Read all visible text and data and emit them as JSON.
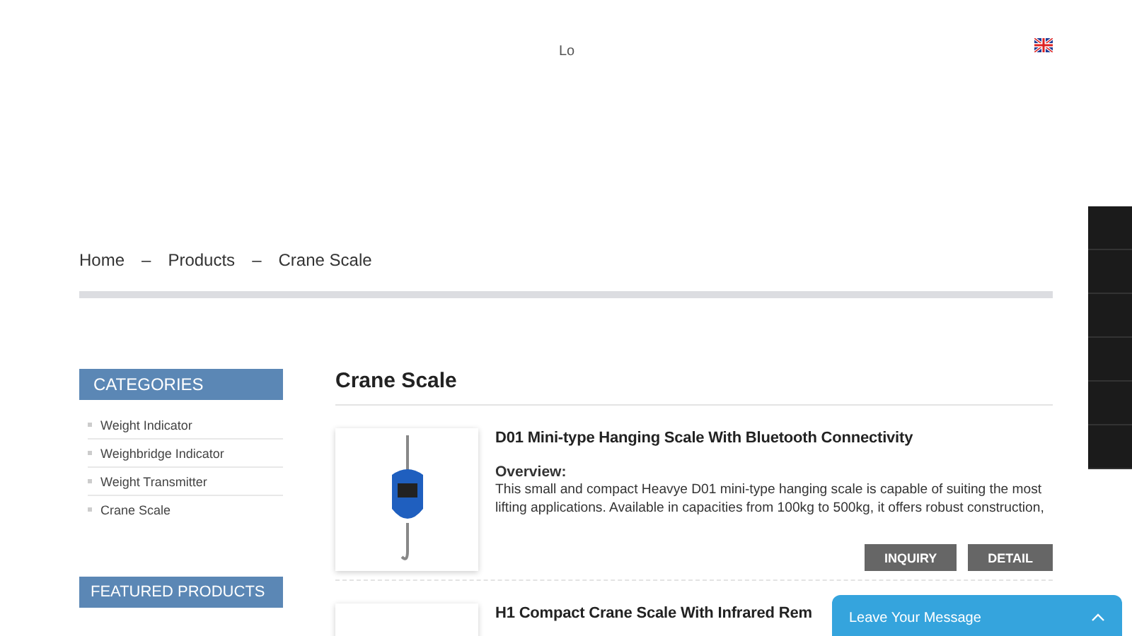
{
  "header": {
    "logo_text": "Lo"
  },
  "breadcrumb": [
    "Home",
    "Products",
    "Crane Scale"
  ],
  "breadcrumb_separator": "–",
  "sidebar": {
    "categories_title": "CATEGORIES",
    "categories": [
      "Weight Indicator",
      "Weighbridge Indicator",
      "Weight Transmitter",
      "Crane Scale"
    ],
    "featured_title": "FEATURED PRODUCTS"
  },
  "main": {
    "title": "Crane Scale",
    "products": [
      {
        "kind": "full",
        "title": "D01 Mini-type Hanging Scale With Bluetooth Connectivity",
        "overview_label": "Overview:",
        "description": "This small and compact Heavye D01 mini-type hanging scale is capable of suiting the most lifting applications. Available in capacities from 100kg to 500kg, it offers robust construction,",
        "buttons": [
          "INQUIRY",
          "DETAIL"
        ]
      },
      {
        "kind": "cut",
        "title": "H1 Compact Crane Scale With Infrared Rem"
      }
    ]
  },
  "message_bar": {
    "label": "Leave Your Message",
    "expanded": false
  }
}
